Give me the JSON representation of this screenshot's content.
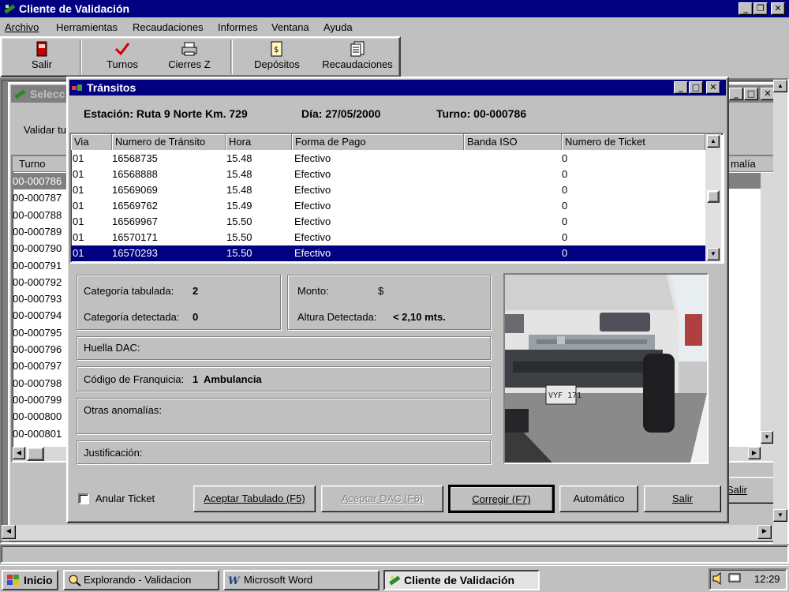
{
  "app": {
    "title": "Cliente de Validación"
  },
  "menu": [
    "Archivo",
    "Herramientas",
    "Recaudaciones",
    "Informes",
    "Ventana",
    "Ayuda"
  ],
  "toolbar": {
    "salir": "Salir",
    "turnos": "Turnos",
    "cierres": "Cierres Z",
    "depositos": "Depósitos",
    "recaudaciones": "Recaudaciones"
  },
  "bgwindow": {
    "title": "Selecc",
    "validar": "Validar tu",
    "col_turno": "Turno",
    "col_anomalia": "malía",
    "turnos": [
      "00-000786",
      "00-000787",
      "00-000788",
      "00-000789",
      "00-000790",
      "00-000791",
      "00-000792",
      "00-000793",
      "00-000794",
      "00-000795",
      "00-000796",
      "00-000797",
      "00-000798",
      "00-000799",
      "00-000800",
      "00-000801"
    ],
    "salir": "Salir"
  },
  "dialog": {
    "title": "Tránsitos",
    "estacion": "Estación: Ruta 9 Norte Km. 729",
    "dia": "Día: 27/05/2000",
    "turno": "Turno: 00-000786",
    "columns": [
      "Via",
      "Numero de Tránsito",
      "Hora",
      "Forma de Pago",
      "Banda ISO",
      "Numero de Ticket"
    ],
    "rows": [
      {
        "via": "01",
        "numero": "16568735",
        "hora": "15.48",
        "forma": "Efectivo",
        "banda": "",
        "ticket": "0"
      },
      {
        "via": "01",
        "numero": "16568888",
        "hora": "15.48",
        "forma": "Efectivo",
        "banda": "",
        "ticket": "0"
      },
      {
        "via": "01",
        "numero": "16569069",
        "hora": "15.48",
        "forma": "Efectivo",
        "banda": "",
        "ticket": "0"
      },
      {
        "via": "01",
        "numero": "16569762",
        "hora": "15.49",
        "forma": "Efectivo",
        "banda": "",
        "ticket": "0"
      },
      {
        "via": "01",
        "numero": "16569967",
        "hora": "15.50",
        "forma": "Efectivo",
        "banda": "",
        "ticket": "0"
      },
      {
        "via": "01",
        "numero": "16570171",
        "hora": "15.50",
        "forma": "Efectivo",
        "banda": "",
        "ticket": "0"
      },
      {
        "via": "01",
        "numero": "16570293",
        "hora": "15.50",
        "forma": "Efectivo",
        "banda": "",
        "ticket": "0"
      }
    ],
    "cat_tabulada_label": "Categoría tabulada:",
    "cat_tabulada_value": "2",
    "cat_detectada_label": "Categoría detectada:",
    "cat_detectada_value": "0",
    "monto_label": "Monto:",
    "monto_value": "$",
    "altura_label": "Altura Detectada:",
    "altura_value": "< 2,10 mts.",
    "huella_label": "Huella DAC:",
    "franquicia_label": "Código de Franquicia:",
    "franquicia_value": "1  Ambulancia",
    "otras_label": "Otras anomalías:",
    "justificacion_label": "Justificación:",
    "anular_label": "Anular Ticket",
    "plate_text": "VYF 171",
    "buttons": {
      "aceptar_tab": "Aceptar Tabulado (F5)",
      "aceptar_dac": "Aceptar DAC (F6)",
      "corregir": "Corregir (F7)",
      "automatico": "Automático",
      "salir": "Salir"
    }
  },
  "taskbar": {
    "inicio": "Inicio",
    "explorando": "Explorando - Validacion",
    "word": "Microsoft Word",
    "cliente": "Cliente de Validación",
    "clock": "12:29"
  },
  "colors": {
    "title": "#000080",
    "face": "#c0c0c0",
    "select": "#000080"
  }
}
